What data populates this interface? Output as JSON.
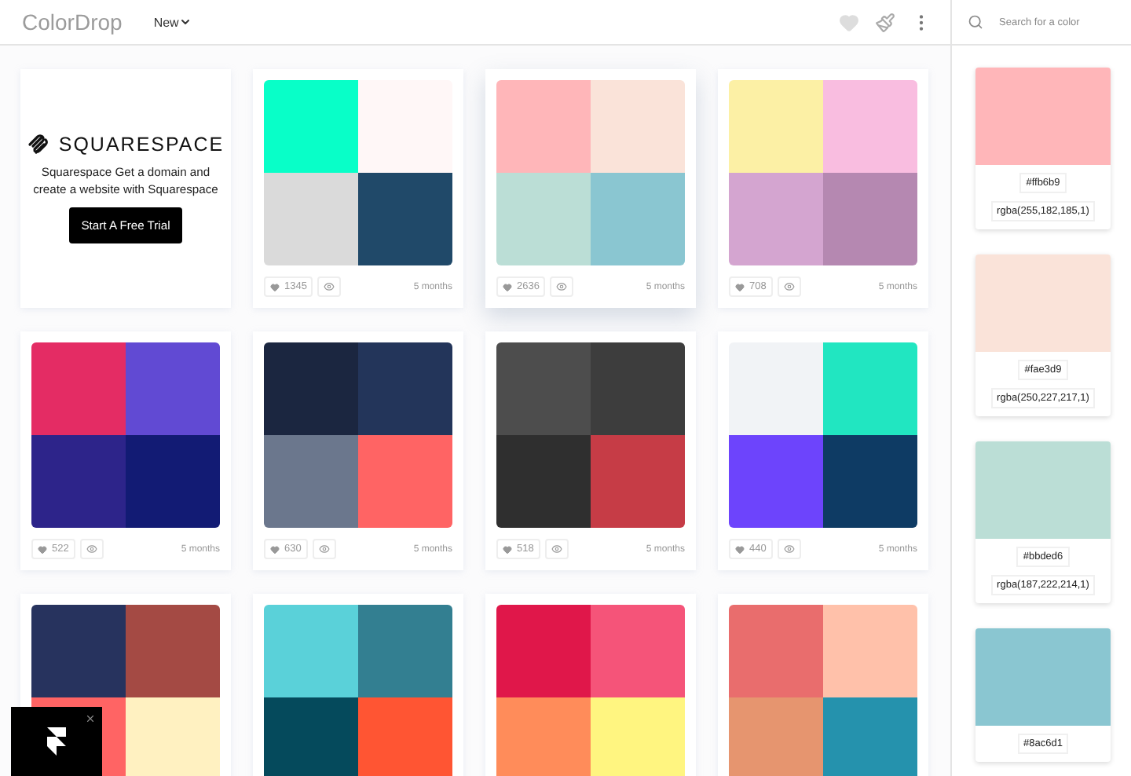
{
  "header": {
    "logo": "ColorDrop",
    "sort_menu": "New"
  },
  "search": {
    "placeholder": "Search for a color"
  },
  "ad": {
    "brand": "SQUARESPACE",
    "text": "Squarespace Get a domain and create a website with Squarespace",
    "button": "Start A Free Trial"
  },
  "palettes": [
    {
      "swatches": [
        {
          "color": "#08ffc8"
        },
        {
          "color": "#fff7f7"
        },
        {
          "color": "#dadada"
        },
        {
          "color": "#204969"
        }
      ],
      "likes": "1345",
      "age": "5 months",
      "selected": false
    },
    {
      "swatches": [
        {
          "color": "#ffb6b9"
        },
        {
          "color": "#fae3d9"
        },
        {
          "color": "#bbded6"
        },
        {
          "color": "#8ac6d1"
        }
      ],
      "likes": "2636",
      "age": "5 months",
      "selected": true
    },
    {
      "swatches": [
        {
          "color": "#fcf0a5"
        },
        {
          "color": "#f9bde0"
        },
        {
          "color": "#d4a5d0"
        },
        {
          "color": "#b588b1"
        }
      ],
      "likes": "708",
      "age": "5 months",
      "selected": false
    },
    {
      "swatches": [
        {
          "color": "#e42c64"
        },
        {
          "color": "#614ad3"
        },
        {
          "color": "#2d248a"
        },
        {
          "color": "#121b74"
        }
      ],
      "likes": "522",
      "age": "5 months",
      "selected": false
    },
    {
      "swatches": [
        {
          "color": "#1b2640"
        },
        {
          "color": "#23355a"
        },
        {
          "color": "#6b778d"
        },
        {
          "color": "#ff6464"
        }
      ],
      "likes": "630",
      "age": "5 months",
      "selected": false
    },
    {
      "swatches": [
        {
          "color": "#4d4d4d"
        },
        {
          "color": "#3d3d3d"
        },
        {
          "color": "#2f2f2f"
        },
        {
          "color": "#c63c46"
        }
      ],
      "likes": "518",
      "age": "5 months",
      "selected": false
    },
    {
      "swatches": [
        {
          "color": "#f1f3f6"
        },
        {
          "color": "#21e6c1"
        },
        {
          "color": "#6d44fc"
        },
        {
          "color": "#0e3b64"
        }
      ],
      "likes": "440",
      "age": "5 months",
      "selected": false
    },
    {
      "swatches": [
        {
          "color": "#27335e"
        },
        {
          "color": "#a44a44"
        },
        {
          "color": "#ff6464"
        },
        {
          "color": "#fff1c1"
        }
      ],
      "selected": false
    },
    {
      "swatches": [
        {
          "color": "#5ad1d9"
        },
        {
          "color": "#337f91"
        },
        {
          "color": "#054a5c"
        },
        {
          "color": "#ff5533"
        }
      ],
      "selected": false
    },
    {
      "swatches": [
        {
          "color": "#e0174a"
        },
        {
          "color": "#f55479"
        },
        {
          "color": "#ff8c5a"
        },
        {
          "color": "#fff580"
        }
      ],
      "selected": false
    },
    {
      "swatches": [
        {
          "color": "#e96d6d"
        },
        {
          "color": "#ffc1aa"
        },
        {
          "color": "#e6956f"
        },
        {
          "color": "#2592ad"
        }
      ],
      "selected": false
    }
  ],
  "swatches": [
    {
      "color": "#ffb6b9",
      "hex": "#ffb6b9",
      "rgba": "rgba(255,182,185,1)"
    },
    {
      "color": "#fae3d9",
      "hex": "#fae3d9",
      "rgba": "rgba(250,227,217,1)"
    },
    {
      "color": "#bbded6",
      "hex": "#bbded6",
      "rgba": "rgba(187,222,214,1)"
    },
    {
      "color": "#8ac6d1",
      "hex": "#8ac6d1"
    }
  ]
}
